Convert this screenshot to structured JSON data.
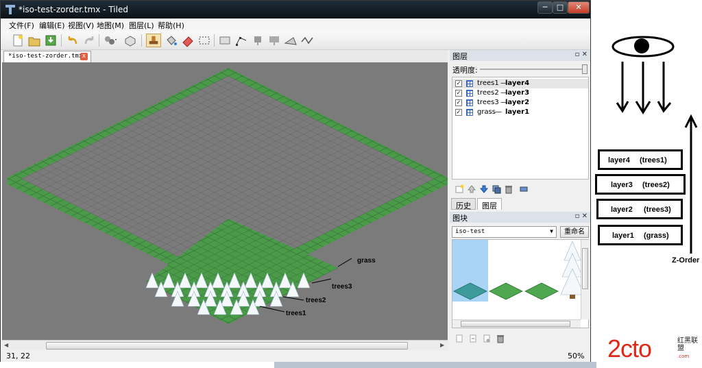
{
  "window": {
    "title": "*iso-test-zorder.tmx - Tiled",
    "controls": {
      "minimize": "─",
      "maximize": "□",
      "close": "✕"
    }
  },
  "menu": [
    "文件(F)",
    "编辑(E)",
    "视图(V)",
    "地图(M)",
    "图层(L)",
    "帮助(H)"
  ],
  "toolbar": {
    "buttons": [
      "new-icon",
      "open-icon",
      "save-icon",
      "undo-icon",
      "redo-icon",
      "stamp-random-icon",
      "stamp-icon",
      "stamp-brush-icon",
      "bucket-fill-icon",
      "eraser-icon",
      "rect-select-icon",
      "object-select-icon",
      "edit-polygon-icon",
      "insert-object-icon",
      "insert-tile-icon",
      "insert-polygon-icon",
      "insert-polyline-icon"
    ]
  },
  "document": {
    "tab_label": "*iso-test-zorder.tmx",
    "tab_close": "x"
  },
  "canvas_labels": {
    "grass": "grass",
    "trees3": "trees3",
    "trees2": "trees2",
    "trees1": "trees1"
  },
  "status": {
    "coords": "31, 22",
    "zoom": "50%"
  },
  "colors": {
    "canvas_bg": "#7b7b7b",
    "grass": "#3f8f3f",
    "grid": "#6a6a6a",
    "selection": "#a9d4f5"
  },
  "layers_panel": {
    "title": "图层",
    "dock_buttons": "▫ ✕",
    "opacity_label": "透明度:",
    "opacity_value": 1.0,
    "layers": [
      {
        "name": "trees1",
        "tag": "layer4",
        "visible": true,
        "selected": true
      },
      {
        "name": "trees2",
        "tag": "layer3",
        "visible": true,
        "selected": false
      },
      {
        "name": "trees3",
        "tag": "layer2",
        "visible": true,
        "selected": false
      },
      {
        "name": "grass",
        "tag": "layer1",
        "visible": true,
        "selected": false
      }
    ],
    "tabs": [
      "历史",
      "图层"
    ],
    "active_tab": "图层"
  },
  "tiles_panel": {
    "title": "图块",
    "dock_buttons": "▫ ✕",
    "tileset": "iso-test",
    "rename": "重命名"
  },
  "annotation": {
    "boxes": [
      {
        "layer": "layer4",
        "tileset": "(trees1)"
      },
      {
        "layer": "layer3",
        "tileset": "(trees2)"
      },
      {
        "layer": "layer2",
        "tileset": "(trees3)"
      },
      {
        "layer": "layer1",
        "tileset": "(grass)"
      }
    ],
    "zorder_label": "Z-Order"
  },
  "watermark": {
    "brand": "2cto",
    "sub1": "红黑联盟",
    "url": ".com"
  }
}
